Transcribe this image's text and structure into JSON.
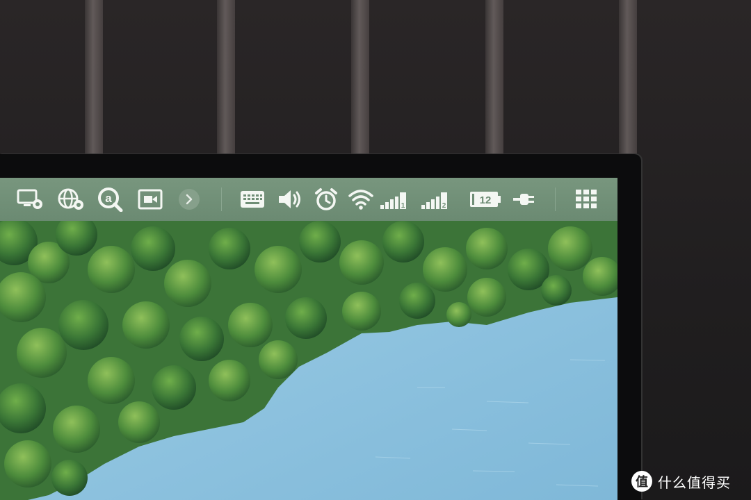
{
  "taskbar": {
    "left_icons": [
      "remote-desktop-icon",
      "network-settings-icon",
      "search-icon",
      "camera-icon",
      "expand-chevron-icon"
    ],
    "right_icons": [
      "keyboard-icon",
      "volume-icon",
      "alarm-icon",
      "wifi-icon",
      "signal-1-icon",
      "signal-2-icon",
      "battery-icon",
      "power-plug-icon",
      "app-grid-icon"
    ],
    "battery_level": "12",
    "sim1_label": "1",
    "sim2_label": "2"
  },
  "watermark": {
    "logo_glyph": "值",
    "text": "什么值得买"
  },
  "colors": {
    "taskbar": "#6f8e76",
    "icon": "#f4f7f3",
    "water": "#8fc4e0",
    "forest": "#3f7a3a"
  }
}
